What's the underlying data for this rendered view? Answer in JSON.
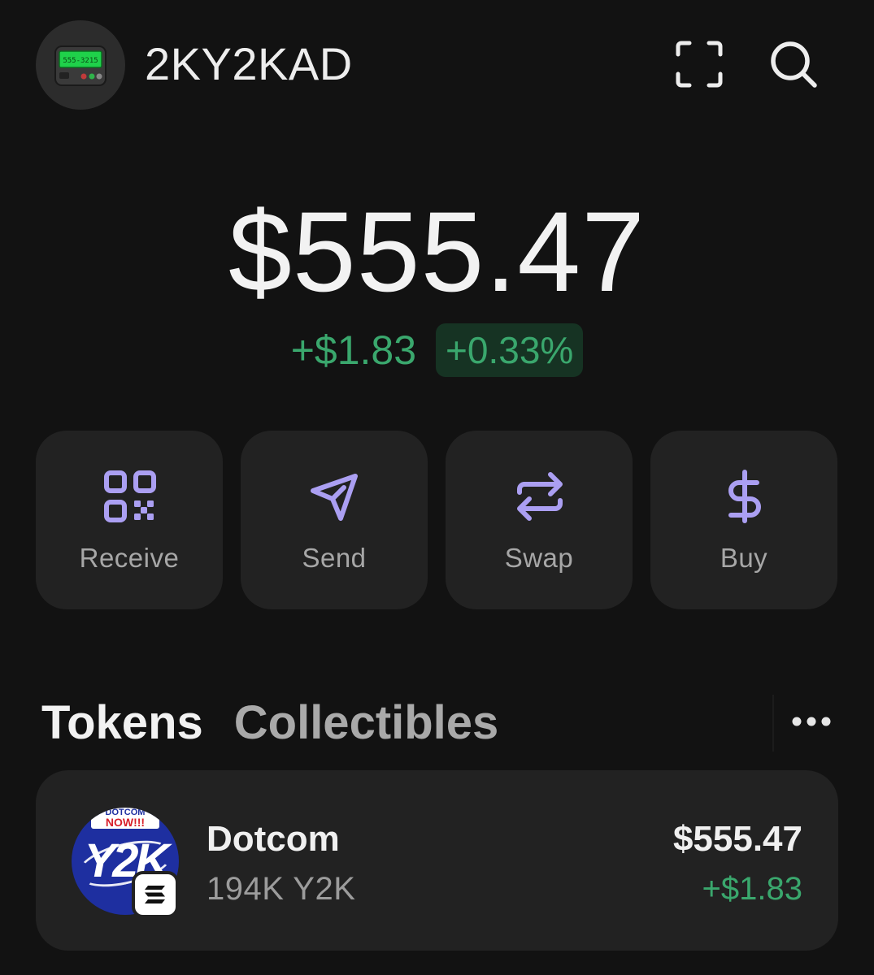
{
  "header": {
    "account_name": "2KY2KAD",
    "avatar_icon": "pager-icon",
    "avatar_pager_text": "555-3215",
    "scan_icon": "scan-icon",
    "search_icon": "search-icon"
  },
  "balance": {
    "total": "$555.47",
    "change_amount": "+$1.83",
    "change_percent": "+0.33%"
  },
  "actions": [
    {
      "label": "Receive",
      "icon": "qr-code-icon"
    },
    {
      "label": "Send",
      "icon": "paper-plane-icon"
    },
    {
      "label": "Swap",
      "icon": "swap-arrows-icon"
    },
    {
      "label": "Buy",
      "icon": "dollar-icon"
    }
  ],
  "tabs": [
    {
      "label": "Tokens",
      "active": true
    },
    {
      "label": "Collectibles",
      "active": false
    }
  ],
  "more_icon": "ellipsis-icon",
  "tokens": [
    {
      "name": "Dotcom",
      "amount": "194K Y2K",
      "value": "$555.47",
      "change": "+$1.83",
      "logo_banner_top": "DOTCOM",
      "logo_banner_bottom": "NOW!!!",
      "logo_text": "Y2K",
      "chain_icon": "solana-icon"
    }
  ],
  "colors": {
    "background": "#121212",
    "card": "#222222",
    "accent_purple": "#ab9ff2",
    "positive_green": "#3aa76d",
    "positive_green_bg": "#163323"
  }
}
